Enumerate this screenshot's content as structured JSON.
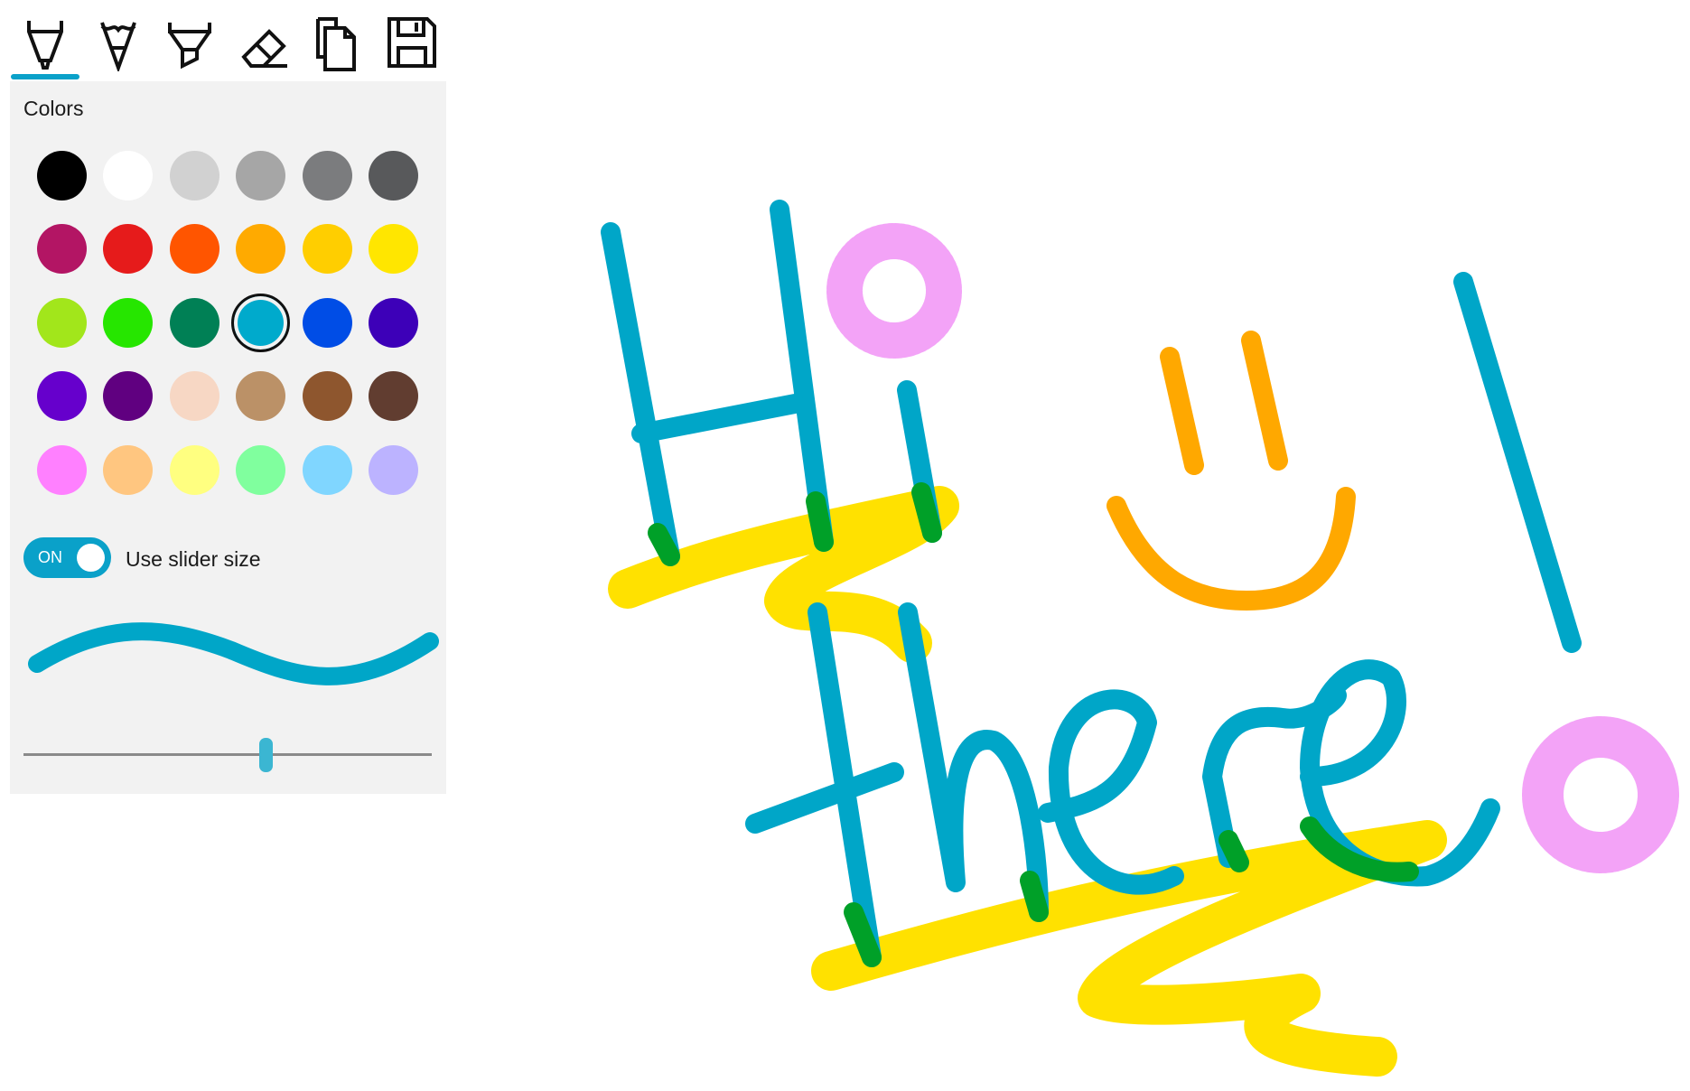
{
  "toolbar": {
    "tools": [
      {
        "name": "pen",
        "icon": "pen-icon"
      },
      {
        "name": "pencil",
        "icon": "pencil-icon"
      },
      {
        "name": "highlighter",
        "icon": "highlighter-icon"
      },
      {
        "name": "eraser",
        "icon": "eraser-icon"
      },
      {
        "name": "copy",
        "icon": "copy-icon"
      },
      {
        "name": "save",
        "icon": "save-icon"
      }
    ],
    "active_tool": "pen"
  },
  "flyout": {
    "title": "Colors",
    "palette": [
      [
        "#000000",
        "#ffffff",
        "#d1d1d1",
        "#a6a6a6",
        "#7b7c7e",
        "#58595b"
      ],
      [
        "#b31564",
        "#e61b1b",
        "#ff5500",
        "#ffaa00",
        "#ffce00",
        "#ffe600"
      ],
      [
        "#a2e61b",
        "#26e600",
        "#008055",
        "#00aacc",
        "#004de6",
        "#3d00b8"
      ],
      [
        "#6600cc",
        "#600080",
        "#f7d7c4",
        "#bb9167",
        "#8e562e",
        "#613d30"
      ],
      [
        "#ff80ff",
        "#ffc680",
        "#ffff80",
        "#80ff9e",
        "#80d6ff",
        "#bcb3ff"
      ]
    ],
    "selected_color": "#00aacc",
    "toggle": {
      "state": "ON",
      "label": "Use slider size"
    },
    "size_slider": {
      "value": 0.6
    }
  },
  "canvas": {
    "accent_colors": {
      "blue": "#00a6c8",
      "yellow": "#ffe100",
      "orange": "#ffa800",
      "pink": "#f08cf5"
    }
  }
}
